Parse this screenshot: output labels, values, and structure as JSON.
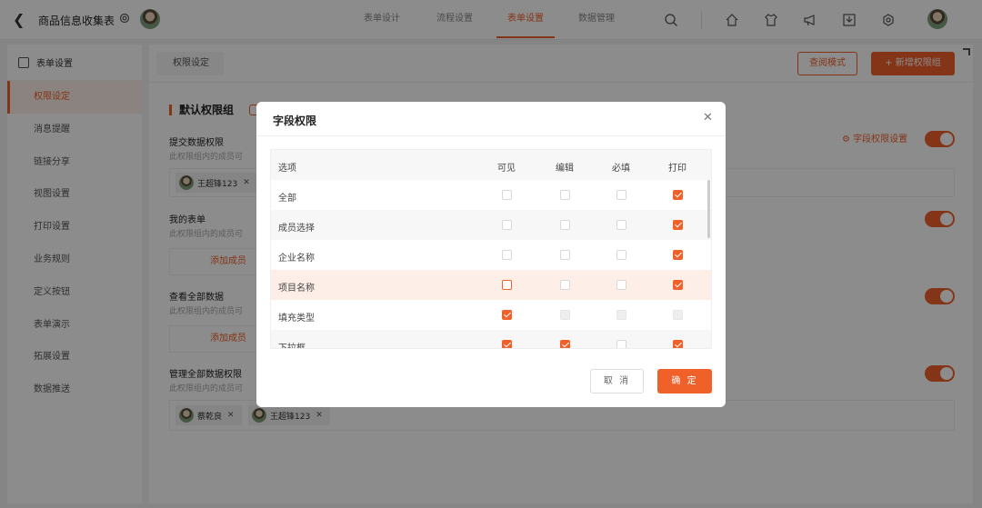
{
  "header": {
    "back_icon": "chevron-left-icon",
    "app_title": "商品信息收集表",
    "nav_tabs": [
      {
        "label": "表单设计",
        "active": false
      },
      {
        "label": "流程设置",
        "active": false
      },
      {
        "label": "表单设置",
        "active": true
      },
      {
        "label": "数据管理",
        "active": false
      }
    ],
    "tool_icons": [
      "search-icon",
      "home-icon",
      "shirt-icon",
      "megaphone-icon",
      "download-icon",
      "settings-icon"
    ]
  },
  "sidebar": {
    "header": "表单设置",
    "items": [
      {
        "label": "权限设定",
        "active": true
      },
      {
        "label": "消息提醒",
        "active": false
      },
      {
        "label": "链接分享",
        "active": false
      },
      {
        "label": "视图设置",
        "active": false
      },
      {
        "label": "打印设置",
        "active": false
      },
      {
        "label": "业务规则",
        "active": false
      },
      {
        "label": "定义按钮",
        "active": false
      },
      {
        "label": "表单演示",
        "active": false
      },
      {
        "label": "拓展设置",
        "active": false
      },
      {
        "label": "数据推送",
        "active": false
      }
    ]
  },
  "content": {
    "crumb": "权限设定",
    "view_mode_button": "查阅模式",
    "add_group_button": "新增权限组",
    "group_title": "默认权限组",
    "field_permission_link": "字段权限设置",
    "sections": [
      {
        "label": "提交数据权限",
        "sub": "此权限组内的成员可"
      },
      {
        "label": "我的表单",
        "sub": "此权限组内的成员可",
        "add_label": "添加成员"
      },
      {
        "label": "查看全部数据",
        "sub": "此权限组内的成员可",
        "add_label": "添加成员"
      },
      {
        "label": "管理全部数据权限",
        "sub": "此权限组内的成员可"
      }
    ],
    "members_submit": [
      "王超锋123"
    ],
    "members_manage": [
      "蔡乾良",
      "王超锋123"
    ]
  },
  "modal": {
    "title": "字段权限",
    "columns": [
      "选项",
      "可见",
      "编辑",
      "必填",
      "打印"
    ],
    "rows": [
      {
        "name": "全部",
        "visible": "unchecked",
        "edit": "unchecked",
        "required": "unchecked",
        "print": "checked"
      },
      {
        "name": "成员选择",
        "visible": "unchecked",
        "edit": "unchecked",
        "required": "unchecked",
        "print": "checked"
      },
      {
        "name": "企业名称",
        "visible": "unchecked",
        "edit": "unchecked",
        "required": "unchecked",
        "print": "checked"
      },
      {
        "name": "项目名称",
        "visible": "unchecked-highlight",
        "edit": "unchecked",
        "required": "unchecked",
        "print": "checked"
      },
      {
        "name": "填充类型",
        "visible": "checked",
        "edit": "disabled",
        "required": "disabled",
        "print": "disabled"
      },
      {
        "name": "下拉框",
        "visible": "checked",
        "edit": "checked",
        "required": "unchecked",
        "print": "checked"
      }
    ],
    "cancel_label": "取 消",
    "ok_label": "确 定"
  },
  "colors": {
    "accent": "#f0612a",
    "overlay": "rgba(0,0,0,0.45)"
  }
}
